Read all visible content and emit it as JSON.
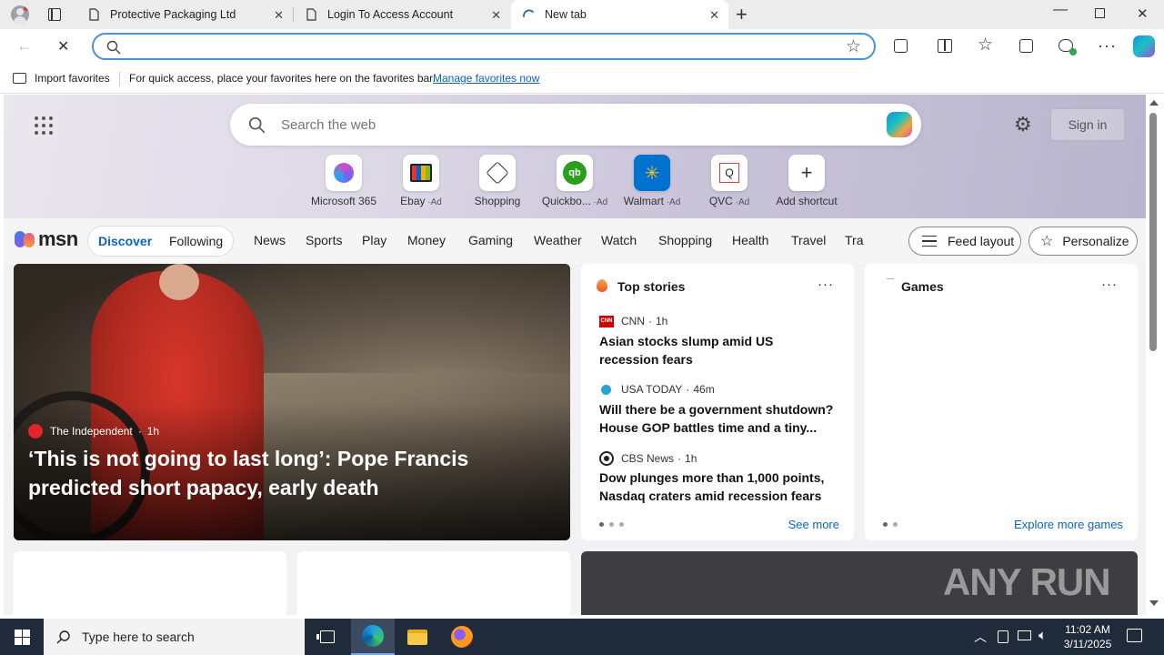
{
  "tabs": [
    {
      "title": "Protective Packaging Ltd",
      "active": false
    },
    {
      "title": "Login To Access Account",
      "active": false
    },
    {
      "title": "New tab",
      "active": true
    }
  ],
  "favorites_bar": {
    "import_label": "Import favorites",
    "hint": "For quick access, place your favorites here on the favorites bar.",
    "manage_link": "Manage favorites now"
  },
  "address_bar": {
    "value": ""
  },
  "newtab": {
    "search_placeholder": "Search the web",
    "sign_in": "Sign in",
    "shortcuts": [
      {
        "label": "Microsoft 365",
        "ad": "",
        "icon": "microsoft-365-icon"
      },
      {
        "label": "Ebay",
        "ad": "Ad",
        "icon": "ebay-icon"
      },
      {
        "label": "Shopping",
        "ad": "",
        "icon": "shopping-tag-icon"
      },
      {
        "label": "Quickbo...",
        "ad": "Ad",
        "icon": "quickbooks-icon"
      },
      {
        "label": "Walmart",
        "ad": "Ad",
        "icon": "walmart-icon"
      },
      {
        "label": "QVC",
        "ad": "Ad",
        "icon": "qvc-icon"
      },
      {
        "label": "Add shortcut",
        "ad": "",
        "icon": "plus-icon"
      }
    ]
  },
  "msn": {
    "logo": "msn",
    "tabs": [
      "Discover",
      "Following"
    ],
    "nav": [
      "News",
      "Sports",
      "Play",
      "Money",
      "Gaming",
      "Weather",
      "Watch",
      "Shopping",
      "Health",
      "Travel",
      "Tra"
    ],
    "feed_layout": "Feed layout",
    "personalize": "Personalize"
  },
  "hero_story": {
    "source": "The Independent",
    "age": "1h",
    "headline": "‘This is not going to last long’: Pope Francis predicted short papacy, early death"
  },
  "top_stories": {
    "title": "Top stories",
    "items": [
      {
        "source": "CNN",
        "age": "1h",
        "headline": "Asian stocks slump amid US recession fears"
      },
      {
        "source": "USA TODAY",
        "age": "46m",
        "headline": "Will there be a government shutdown? House GOP battles time and a tiny..."
      },
      {
        "source": "CBS News",
        "age": "1h",
        "headline": "Dow plunges more than 1,000 points, Nasdaq craters amid recession fears"
      }
    ],
    "see_more": "See more"
  },
  "games": {
    "title": "Games",
    "explore": "Explore more games"
  },
  "watermark": "ANY RUN",
  "taskbar": {
    "search_placeholder": "Type here to search",
    "time": "11:02 AM",
    "date": "3/11/2025"
  },
  "colors": {
    "accent": "#0b63c5",
    "tabbar": "#ececec",
    "taskbar": "#1f2a3a",
    "hero_red": "#c8281e"
  }
}
